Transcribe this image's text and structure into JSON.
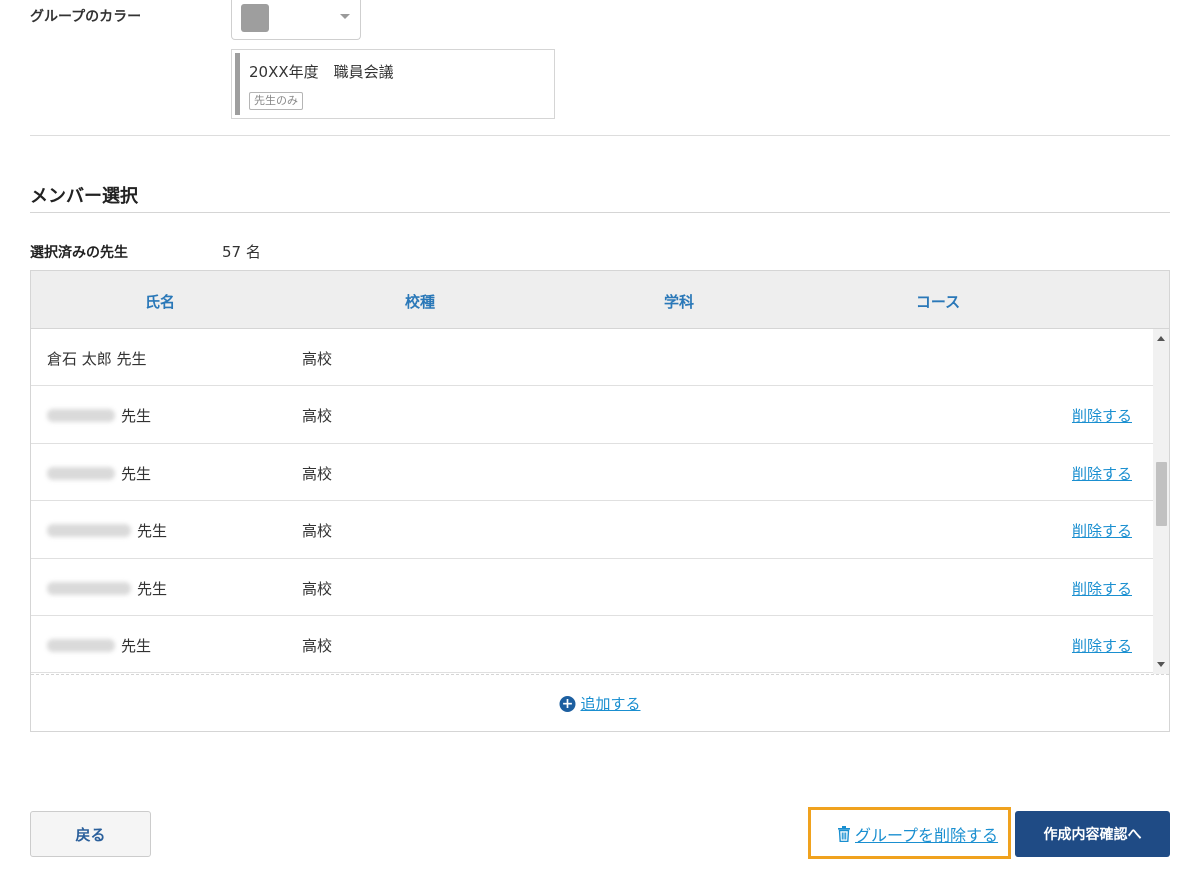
{
  "group_color": {
    "label": "グループのカラー",
    "selected_color": "#9e9e9e"
  },
  "preview": {
    "title": "20XX年度　職員会議",
    "tag": "先生のみ"
  },
  "member_section": {
    "title": "メンバー選択",
    "selected_label": "選択済みの先生",
    "selected_count": "57 名"
  },
  "table": {
    "headers": [
      "氏名",
      "校種",
      "学科",
      "コース"
    ],
    "rows": [
      {
        "name": "倉石 太郎 先生",
        "school": "高校",
        "delete": ""
      },
      {
        "name": "先生",
        "school": "高校",
        "delete": "削除する"
      },
      {
        "name": "先生",
        "school": "高校",
        "delete": "削除する"
      },
      {
        "name": "先生",
        "school": "高校",
        "delete": "削除する"
      },
      {
        "name": "先生",
        "school": "高校",
        "delete": "削除する"
      },
      {
        "name": "先生",
        "school": "高校",
        "delete": "削除する"
      }
    ],
    "add_label": "追加する"
  },
  "footer": {
    "back_label": "戻る",
    "delete_group_label": "グループを削除する",
    "confirm_label": "作成内容確認へ"
  },
  "colors": {
    "accent_link": "#1a8fd0",
    "primary_button": "#1f4b85",
    "highlight": "#f0a21e",
    "header_text": "#2a78b8"
  }
}
